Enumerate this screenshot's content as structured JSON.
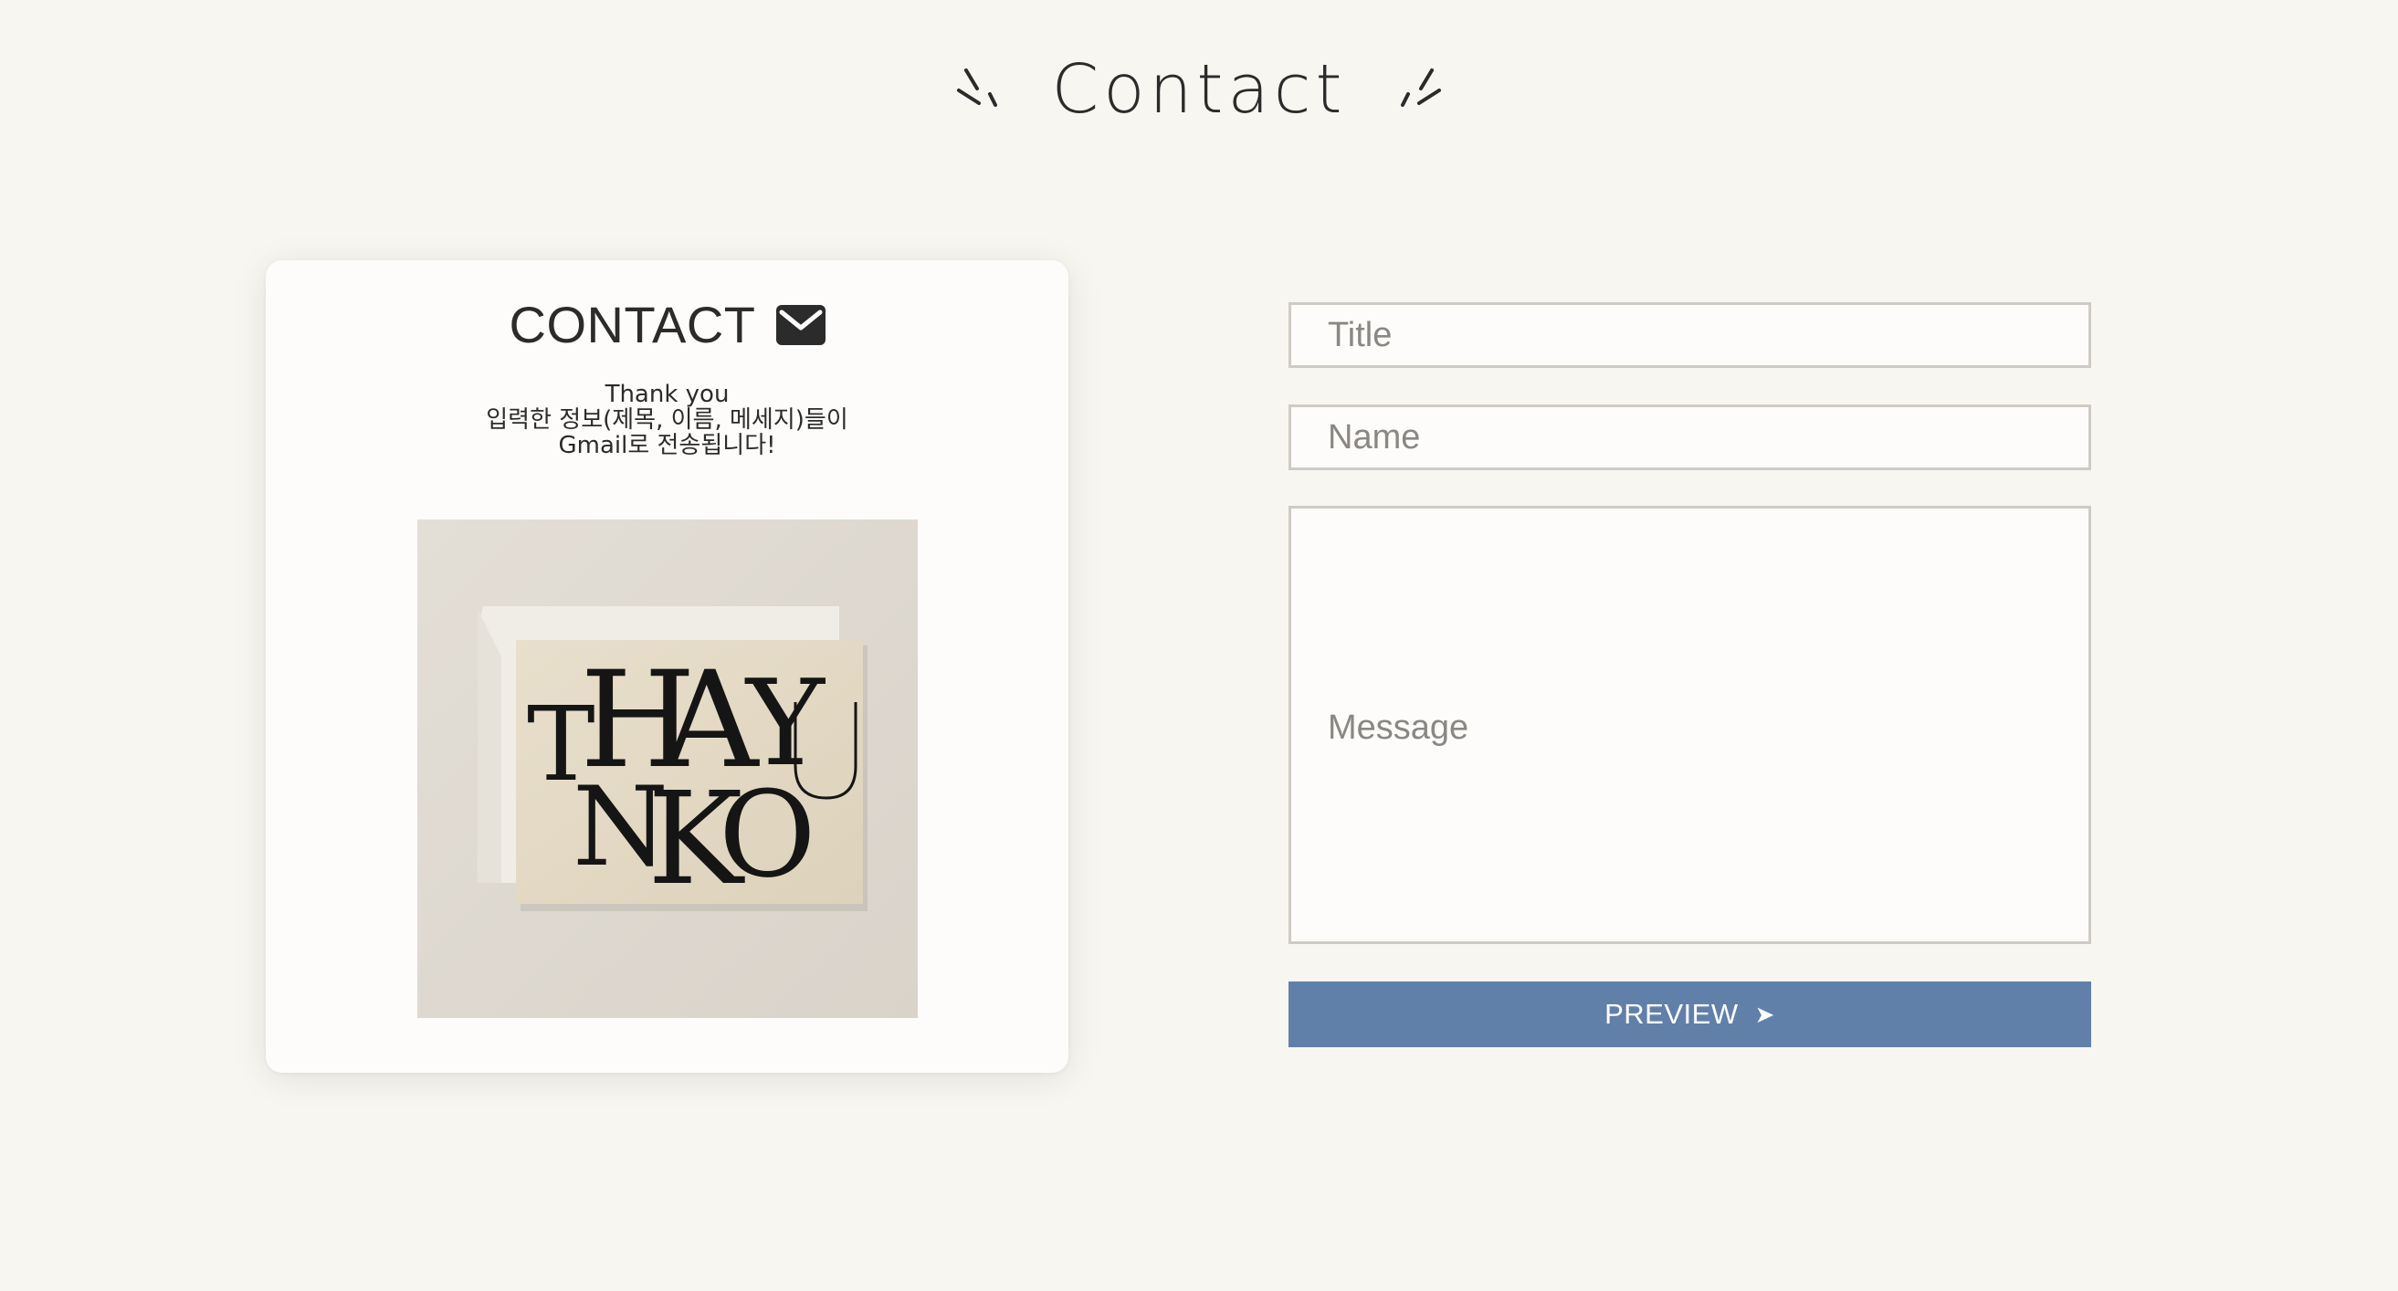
{
  "header": {
    "title": "Contact",
    "left_icon": "sparkle-left-icon",
    "right_icon": "sparkle-right-icon"
  },
  "card": {
    "title": "CONTACT",
    "icon": "mail-icon",
    "message_lines": [
      "Thank you",
      "입력한 정보(제목, 이름, 메세지)들이",
      "Gmail로 전송됩니다!"
    ],
    "image_lettering": "THANK YOU"
  },
  "form": {
    "title_placeholder": "Title",
    "name_placeholder": "Name",
    "message_placeholder": "Message",
    "title_value": "",
    "name_value": "",
    "message_value": "",
    "preview_label": "PREVIEW",
    "preview_arrow": "➤"
  },
  "colors": {
    "background": "#f8f6f0",
    "card": "#fdfcfa",
    "button": "#6080aa",
    "text": "#2b2b2b",
    "field_border": "#cfcbc4"
  }
}
